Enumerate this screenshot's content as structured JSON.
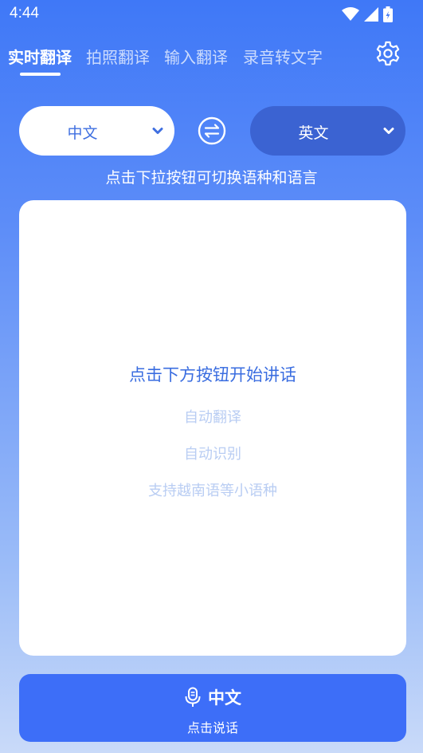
{
  "status_bar": {
    "time": "4:44",
    "icons": [
      "wifi-icon",
      "signal-icon",
      "battery-icon"
    ]
  },
  "tabs": [
    {
      "label": "实时翻译",
      "active": true
    },
    {
      "label": "拍照翻译",
      "active": false
    },
    {
      "label": "输入翻译",
      "active": false
    },
    {
      "label": "录音转文字",
      "active": false
    }
  ],
  "language": {
    "source": "中文",
    "target": "英文",
    "hint": "点击下拉按钮可切换语种和语言"
  },
  "card": {
    "main_text": "点击下方按钮开始讲话",
    "features": [
      "自动翻译",
      "自动识别",
      "支持越南语等小语种"
    ]
  },
  "speak_button": {
    "language": "中文",
    "label": "点击说话"
  },
  "colors": {
    "accent": "#3d6ef8",
    "target_pill": "#3b63d2",
    "card_text": "#3a6de0",
    "card_subtext": "#b9cdf3"
  }
}
